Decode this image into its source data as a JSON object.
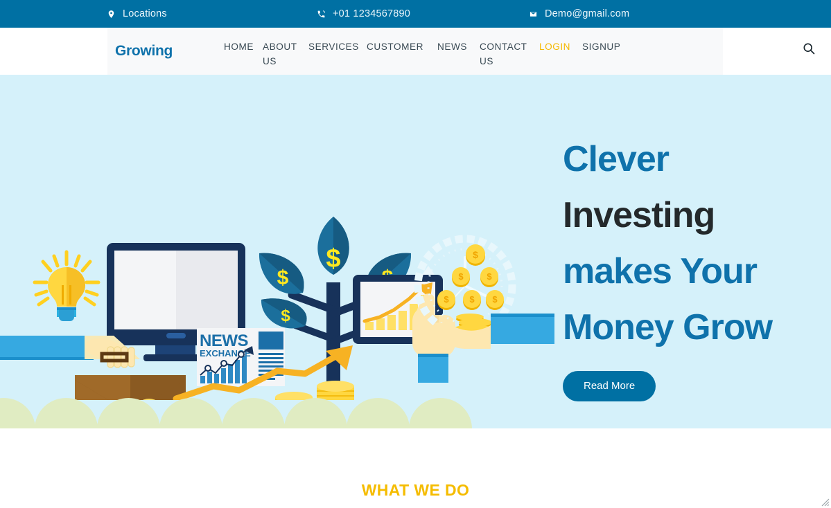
{
  "topbar": {
    "background": "#0070a3",
    "items": [
      {
        "icon": "map-pin-icon",
        "label": "Locations"
      },
      {
        "icon": "phone-icon",
        "label": "+01 1234567890"
      },
      {
        "icon": "envelope-icon",
        "label": "Demo@gmail.com"
      }
    ]
  },
  "nav": {
    "brand": "Growing",
    "brand_color": "#0f72ab",
    "background": "#f8f9fa",
    "items": [
      {
        "label": "HOME",
        "active": false
      },
      {
        "label": "ABOUT US",
        "active": false
      },
      {
        "label": "SERVICES",
        "active": false
      },
      {
        "label": "CUSTOMER",
        "active": false
      },
      {
        "label": "NEWS",
        "active": false
      },
      {
        "label": "CONTACT US",
        "active": false
      },
      {
        "label": "LOGIN",
        "active": true
      },
      {
        "label": "SIGNUP",
        "active": false
      }
    ],
    "login_color": "#f5b800",
    "search_icon": "search-icon"
  },
  "hero": {
    "background": "#d5f1fa",
    "headline_line1": "Clever",
    "headline_line2": "Investing",
    "headline_line3": "makes Your",
    "headline_line4": "Money Grow",
    "headline_color": "#0f72ab",
    "headline_accent_color": "#24292b",
    "cta_label": "Read More",
    "cta_background": "#0070a3",
    "illustration": {
      "name": "investment-growth-illustration",
      "elements": [
        "lightbulb-icon",
        "desktop-monitor",
        "briefcase-with-coins",
        "news-exchange-newspaper",
        "money-tree-with-dollar-leaves",
        "coin-stacks",
        "tablet-with-growth-chart",
        "hand-holding-coins",
        "clock-with-coins"
      ],
      "newspaper_title_line1": "NEWS",
      "newspaper_title_line2": "EXCHANGE",
      "leaf_symbol": "$"
    },
    "bump_color": "#e0ecc2"
  },
  "section": {
    "title": "WHAT WE DO",
    "title_color": "#f5bc00"
  }
}
